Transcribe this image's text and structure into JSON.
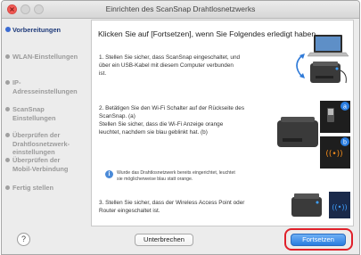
{
  "window": {
    "title": "Einrichten des ScanSnap Drahtlosnetzwerks",
    "close_glyph": "×"
  },
  "sidebar": {
    "items": [
      {
        "label": "Vorbereitungen",
        "active": true
      },
      {
        "label": "WLAN-Einstellungen",
        "active": false
      },
      {
        "label": "IP-\nAdresseinstellungen",
        "active": false
      },
      {
        "label": "ScanSnap\nEinstellungen",
        "active": false
      },
      {
        "label": "Überprüfen der\nDrahtlosnetzwerk-\neinstellungen",
        "active": false
      },
      {
        "label": "Überprüfen der\nMobil-Verbindung",
        "active": false
      },
      {
        "label": "Fertig stellen",
        "active": false
      }
    ]
  },
  "main": {
    "heading": "Klicken Sie auf [Fortsetzen], wenn Sie Folgendes erledigt haben.",
    "step1": "1.  Stellen Sie sicher, dass ScanSnap eingeschaltet, und\n     über ein USB-Kabel mit diesem Computer verbunden\n     ist.",
    "step2": "2.  Betätigen Sie den Wi-Fi Schalter auf der Rückseite des\n     ScanSnap. (a)\n     Stellen Sie sicher, dass die Wi-Fi Anzeige orange\n     leuchtet, nachdem sie blau geblinkt hat. (b)",
    "note": "Wurde das Drahtlosnetzwerk bereits eingerichtet, leuchtet\nsie möglicherweise blau statt orange.",
    "step3": "3.  Stellen Sie sicher, dass der Wireless Access Point oder\n     Router eingeschaltet ist.",
    "callout_a": "a",
    "callout_b": "b"
  },
  "footer": {
    "help_label": "?",
    "cancel_label": "Unterbrechen",
    "next_label": "Fortsetzen"
  },
  "colors": {
    "accent": "#2a7de0",
    "highlight": "#e0202a",
    "wifi_orange": "#f08a1c"
  }
}
